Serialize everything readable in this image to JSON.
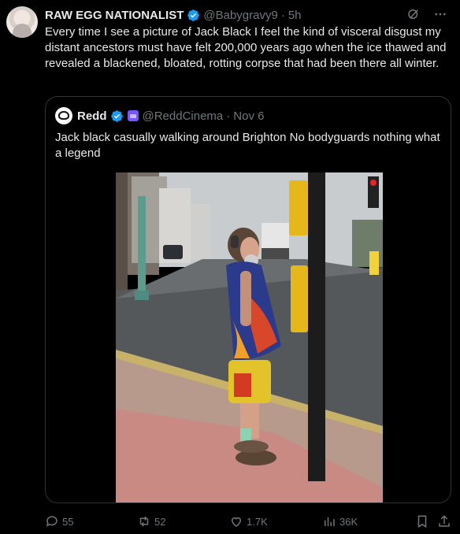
{
  "post": {
    "author_name": "RAW EGG NATIONALIST",
    "author_handle": "@Babygravy9",
    "time": "5h",
    "text": "Every time I see a picture of Jack Black I feel the kind of visceral disgust my distant ancestors must have felt 200,000 years ago when the ice thawed and revealed a blackened, bloated, rotting corpse that had been there all winter."
  },
  "quote": {
    "author_name": "Redd",
    "author_handle": "@ReddCinema",
    "date": "Nov 6",
    "text": "Jack black casually walking around Brighton No bodyguards nothing what a legend"
  },
  "actions": {
    "replies": "55",
    "reposts": "52",
    "likes": "1.7K",
    "views": "36K"
  },
  "colors": {
    "verified": "#1d9bf0",
    "muted": "#71767b",
    "text": "#e7e9ea"
  }
}
